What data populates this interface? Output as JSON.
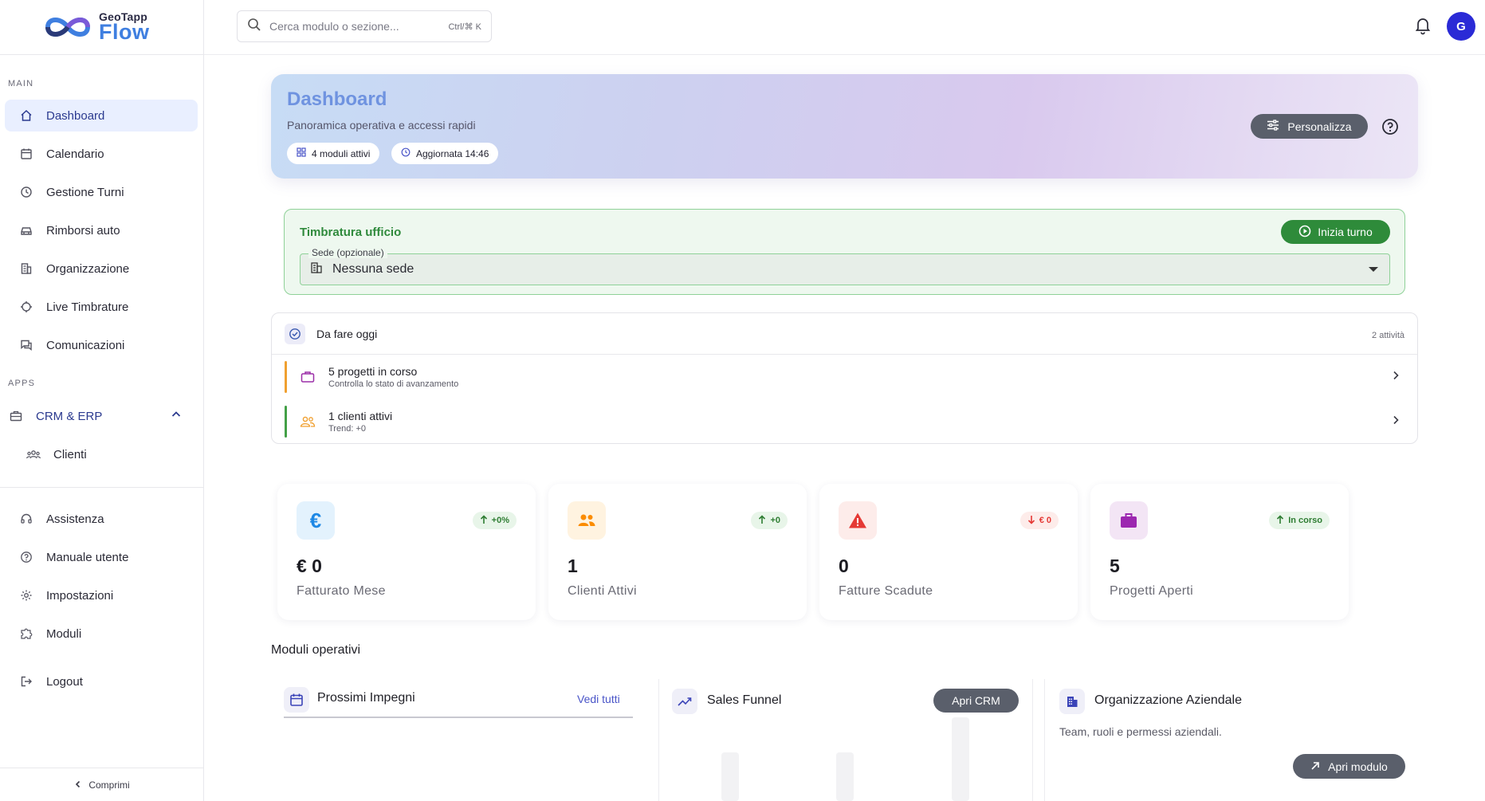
{
  "brand": {
    "top": "GeoTapp",
    "bottom": "Flow"
  },
  "sidebar": {
    "section_main": "MAIN",
    "section_apps": "APPS",
    "main_items": [
      {
        "label": "Dashboard",
        "icon": "home-icon"
      },
      {
        "label": "Calendario",
        "icon": "calendar-icon"
      },
      {
        "label": "Gestione Turni",
        "icon": "clock-icon"
      },
      {
        "label": "Rimborsi auto",
        "icon": "car-icon"
      },
      {
        "label": "Organizzazione",
        "icon": "building-icon"
      },
      {
        "label": "Live Timbrature",
        "icon": "location-icon"
      },
      {
        "label": "Comunicazioni",
        "icon": "chat-icon"
      }
    ],
    "apps_group": {
      "label": "CRM & ERP",
      "icon": "briefcase-icon"
    },
    "apps_items": [
      {
        "label": "Clienti",
        "icon": "people-icon"
      }
    ],
    "bottom_items": [
      {
        "label": "Assistenza",
        "icon": "headset-icon"
      },
      {
        "label": "Manuale utente",
        "icon": "help-icon"
      },
      {
        "label": "Impostazioni",
        "icon": "gear-icon"
      },
      {
        "label": "Moduli",
        "icon": "puzzle-icon"
      },
      {
        "label": "Logout",
        "icon": "logout-icon"
      }
    ],
    "collapse_label": "Comprimi"
  },
  "topbar": {
    "search_placeholder": "Cerca modulo o sezione...",
    "search_shortcut": "Ctrl/⌘ K",
    "avatar_initial": "G"
  },
  "hero": {
    "title": "Dashboard",
    "subtitle": "Panoramica operativa e accessi rapidi",
    "chip_modules": "4 moduli attivi",
    "chip_updated": "Aggiornata 14:46",
    "customize_label": "Personalizza"
  },
  "timbratura": {
    "title": "Timbratura ufficio",
    "start_label": "Inizia turno",
    "select_label": "Sede (opzionale)",
    "select_value": "Nessuna sede"
  },
  "todo": {
    "title": "Da fare oggi",
    "count": "2 attività",
    "items": [
      {
        "title": "5 progetti in corso",
        "subtitle": "Controlla lo stato di avanzamento",
        "color": "#f0a030"
      },
      {
        "title": "1 clienti attivi",
        "subtitle": "Trend: +0",
        "color": "#43a047"
      }
    ]
  },
  "kpis": [
    {
      "value": "€ 0",
      "label": "Fatturato Mese",
      "badge": "+0%",
      "trend": "up",
      "icon": "euro-icon"
    },
    {
      "value": "1",
      "label": "Clienti Attivi",
      "badge": "+0",
      "trend": "up",
      "icon": "people-icon"
    },
    {
      "value": "0",
      "label": "Fatture Scadute",
      "badge": "€ 0",
      "trend": "down",
      "icon": "warning-icon"
    },
    {
      "value": "5",
      "label": "Progetti Aperti",
      "badge": "In corso",
      "trend": "up",
      "icon": "briefcase-icon"
    }
  ],
  "modules": {
    "title": "Moduli operativi",
    "impegni": {
      "title": "Prossimi Impegni",
      "link": "Vedi tutti"
    },
    "funnel": {
      "title": "Sales Funnel",
      "button": "Apri CRM"
    },
    "org": {
      "title": "Organizzazione Aziendale",
      "desc": "Team, ruoli e permessi aziendali.",
      "button": "Apri modulo"
    }
  },
  "colors": {
    "accent": "#2b3a8f",
    "success": "#2e8b3a",
    "danger": "#e53935",
    "neutral_button": "#5a5f6b"
  }
}
